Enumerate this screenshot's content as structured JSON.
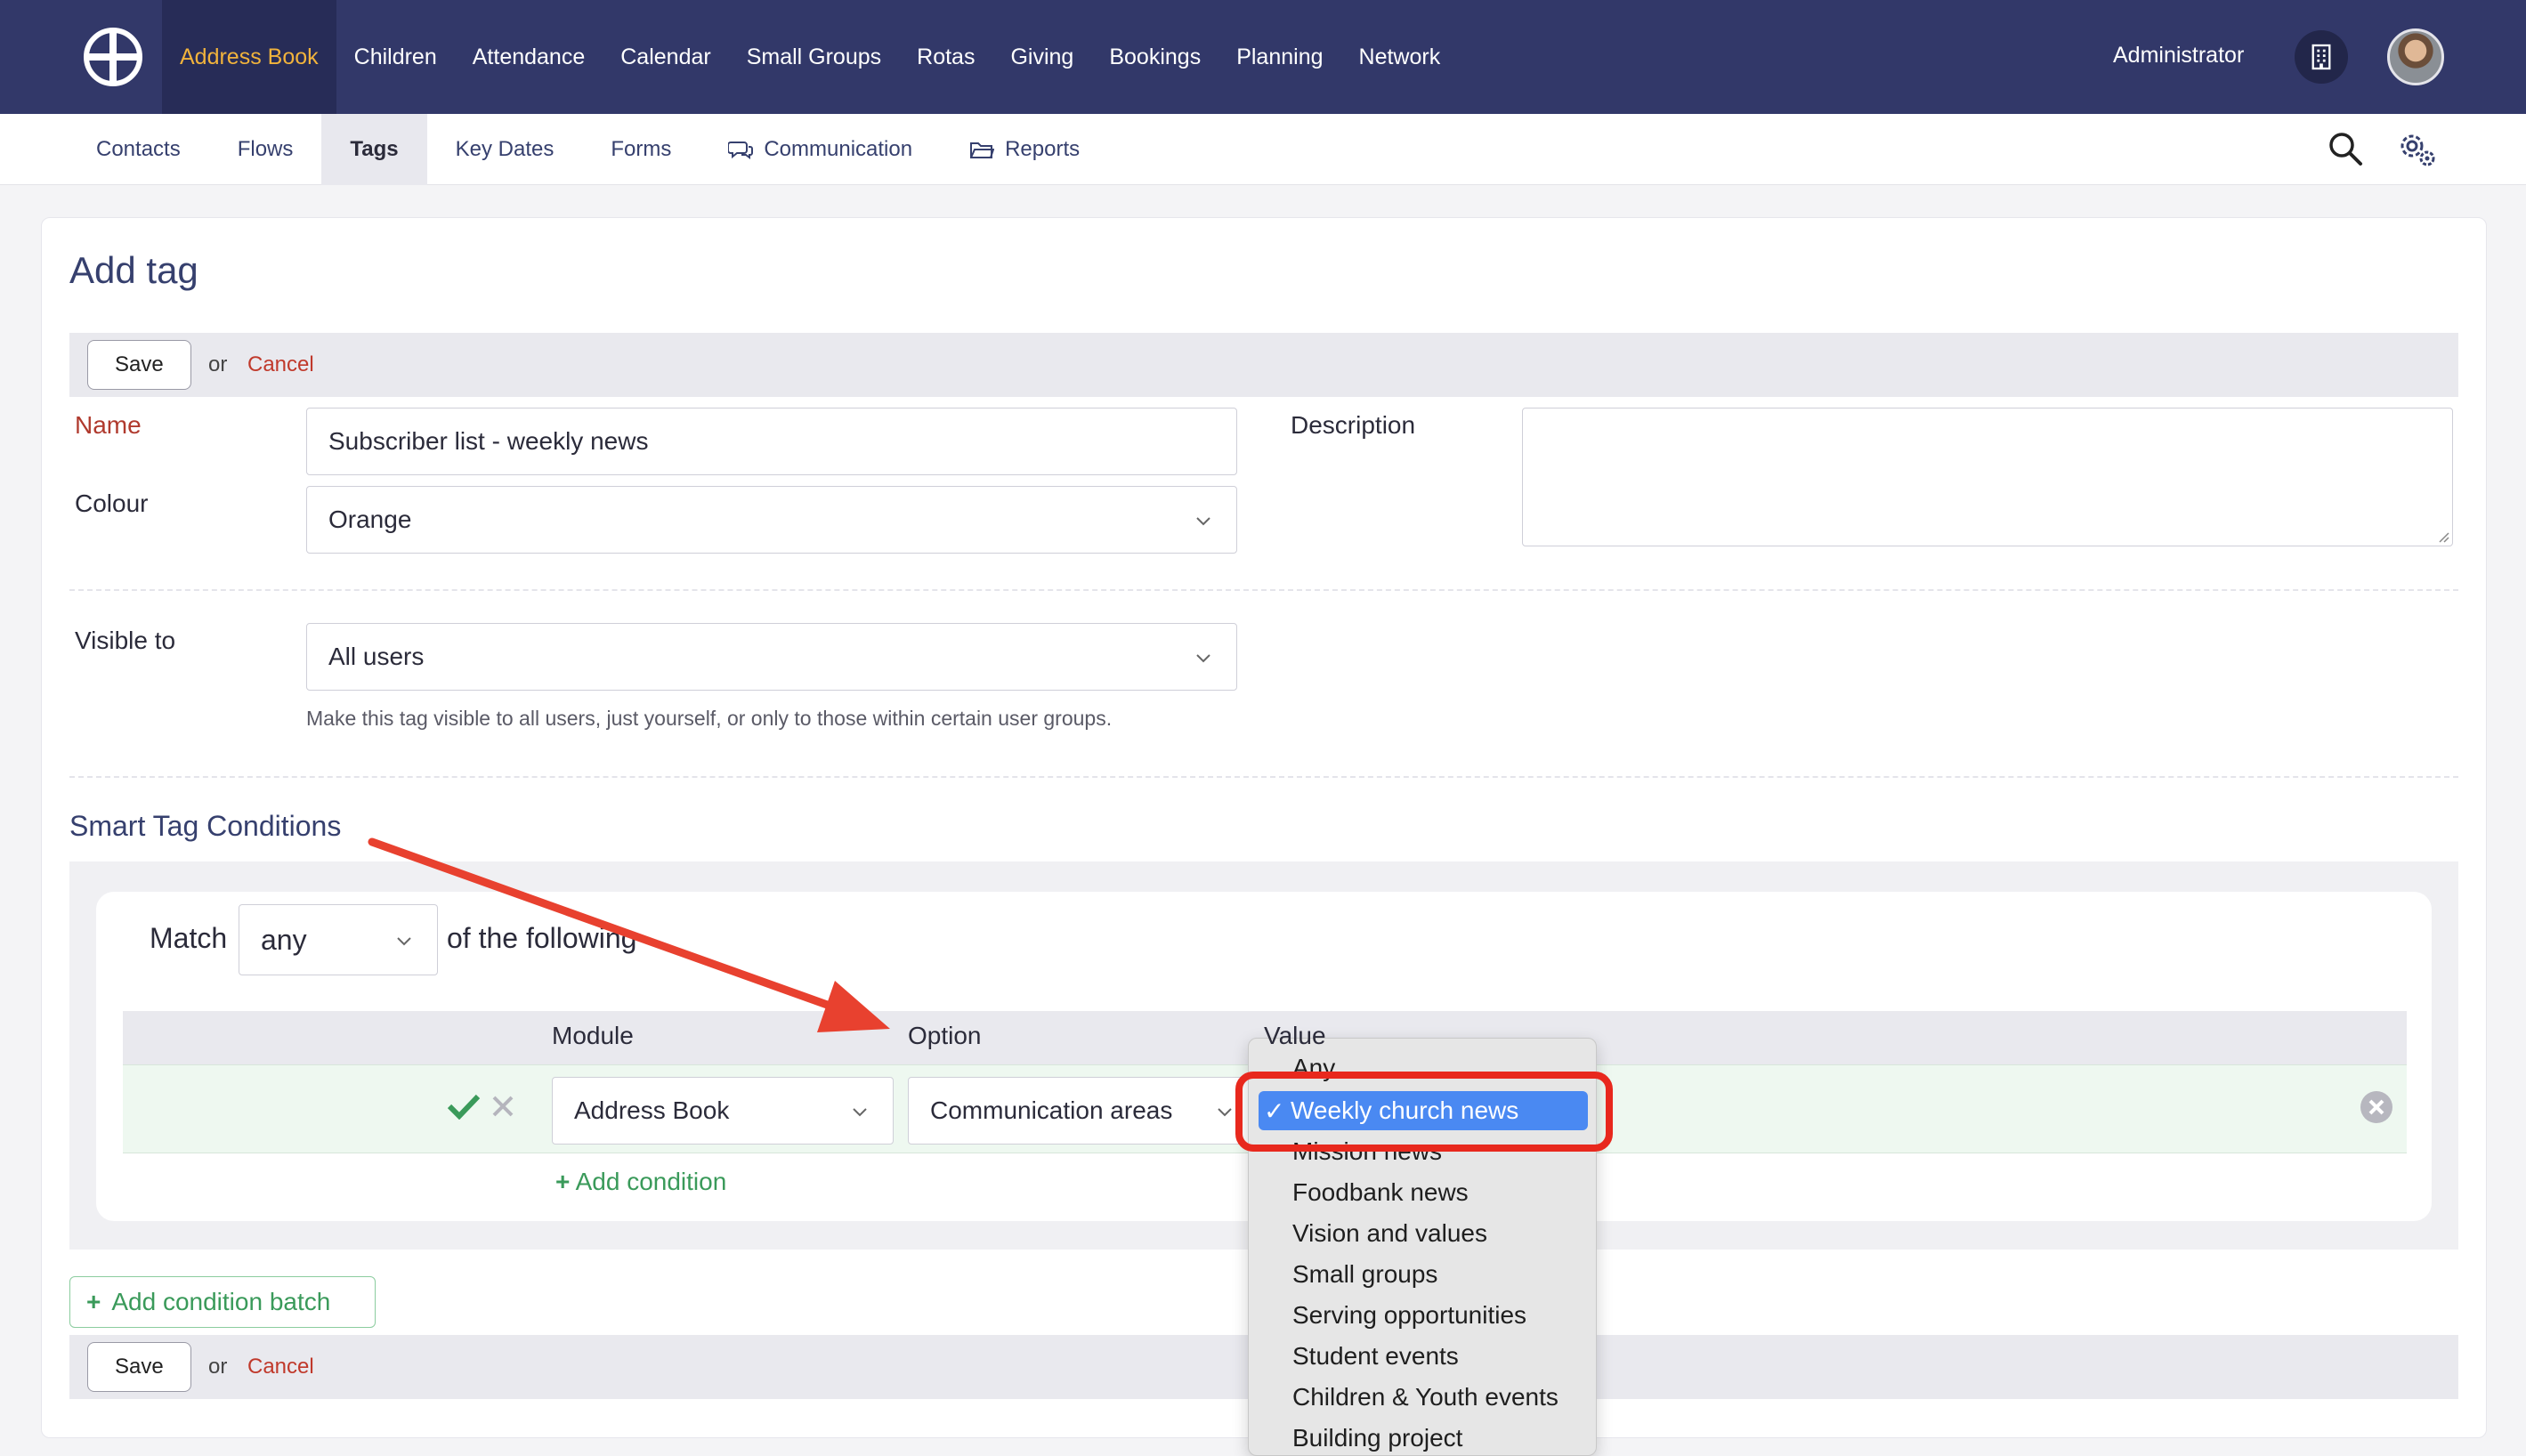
{
  "topnav": {
    "items": [
      "Address Book",
      "Children",
      "Attendance",
      "Calendar",
      "Small Groups",
      "Rotas",
      "Giving",
      "Bookings",
      "Planning",
      "Network"
    ],
    "active": "Address Book",
    "user": "Administrator"
  },
  "subnav": {
    "items": [
      "Contacts",
      "Flows",
      "Tags",
      "Key Dates",
      "Forms",
      "Communication",
      "Reports"
    ],
    "active": "Tags"
  },
  "page": {
    "title": "Add tag"
  },
  "actions": {
    "save": "Save",
    "or": "or",
    "cancel": "Cancel"
  },
  "form": {
    "name_label": "Name",
    "name_value": "Subscriber list - weekly news",
    "colour_label": "Colour",
    "colour_value": "Orange",
    "description_label": "Description",
    "visible_label": "Visible to",
    "visible_value": "All users",
    "visible_hint": "Make this tag visible to all users, just yourself, or only to those within certain user groups."
  },
  "conditions": {
    "title": "Smart Tag Conditions",
    "match_label": "Match",
    "match_value": "any",
    "following": "of the following",
    "headers": {
      "module": "Module",
      "option": "Option",
      "value": "Value"
    },
    "row": {
      "module": "Address Book",
      "option": "Communication areas"
    },
    "add_condition": "Add condition",
    "add_batch": "Add condition batch"
  },
  "dropdown": {
    "options": [
      "Any",
      "Weekly church news",
      "Mission news",
      "Foodbank news",
      "Vision and values",
      "Small groups",
      "Serving opportunities",
      "Student events",
      "Children & Youth events",
      "Building project"
    ],
    "selected": "Weekly church news"
  },
  "colors": {
    "nav_bg": "#323869",
    "active_nav": "#f1b33c",
    "accent_red": "#e8281d",
    "green": "#3a9a5a",
    "select_blue": "#4a89f2"
  }
}
